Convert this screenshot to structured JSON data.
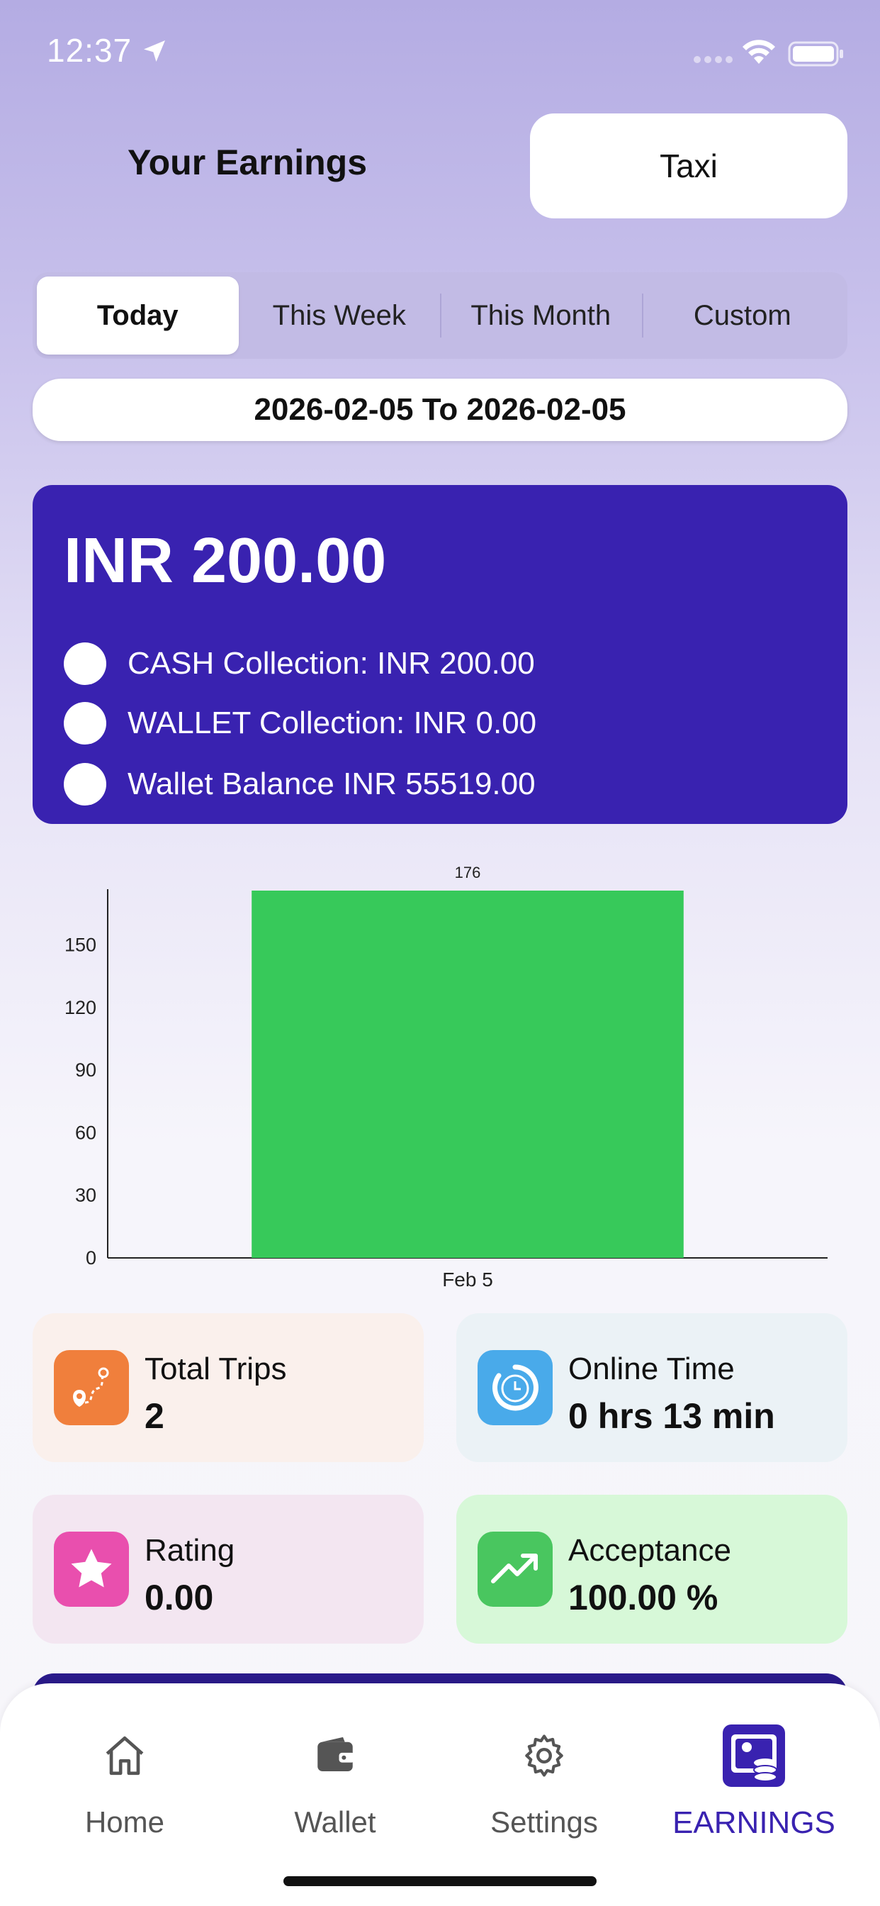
{
  "status_bar": {
    "time": "12:37"
  },
  "header": {
    "title": "Your Earnings",
    "service": "Taxi"
  },
  "period_tabs": [
    {
      "label": "Today",
      "active": true
    },
    {
      "label": "This Week",
      "active": false
    },
    {
      "label": "This Month",
      "active": false
    },
    {
      "label": "Custom",
      "active": false
    }
  ],
  "date_range": "2026-02-05 To 2026-02-05",
  "summary": {
    "total": "INR 200.00",
    "rows": [
      {
        "label": "CASH Collection: INR 200.00"
      },
      {
        "label": "WALLET Collection: INR 0.00"
      },
      {
        "label": "Wallet Balance INR 55519.00"
      }
    ],
    "card_color": "#3922b0"
  },
  "chart_data": {
    "type": "bar",
    "categories": [
      "Feb 5"
    ],
    "values": [
      176
    ],
    "data_labels": [
      "176"
    ],
    "yticks": [
      0,
      30,
      60,
      90,
      120,
      150
    ],
    "ylim": [
      0,
      176
    ],
    "bar_color": "#37c95a",
    "grid": false,
    "legend": "none"
  },
  "stats": [
    {
      "label": "Total Trips",
      "value": "2",
      "icon": "route-icon",
      "icon_color": "#f07f3c",
      "bg": "#faf0ec"
    },
    {
      "label": "Online Time",
      "value": "0 hrs 13 min",
      "icon": "clock-icon",
      "icon_color": "#49aaea",
      "bg": "#ebf2f6"
    },
    {
      "label": "Rating",
      "value": "0.00",
      "icon": "star-icon",
      "icon_color": "#e94fae",
      "bg": "#f3e6f1"
    },
    {
      "label": "Acceptance",
      "value": "100.00 %",
      "icon": "trending-up-icon",
      "icon_color": "#49c65f",
      "bg": "#d7f8d8"
    }
  ],
  "tabbar": {
    "items": [
      {
        "label": "Home",
        "icon": "home-icon",
        "active": false
      },
      {
        "label": "Wallet",
        "icon": "wallet-icon",
        "active": false
      },
      {
        "label": "Settings",
        "icon": "gear-icon",
        "active": false
      },
      {
        "label": "EARNINGS",
        "icon": "earnings-icon",
        "active": true
      }
    ],
    "active_color": "#3922b0"
  }
}
